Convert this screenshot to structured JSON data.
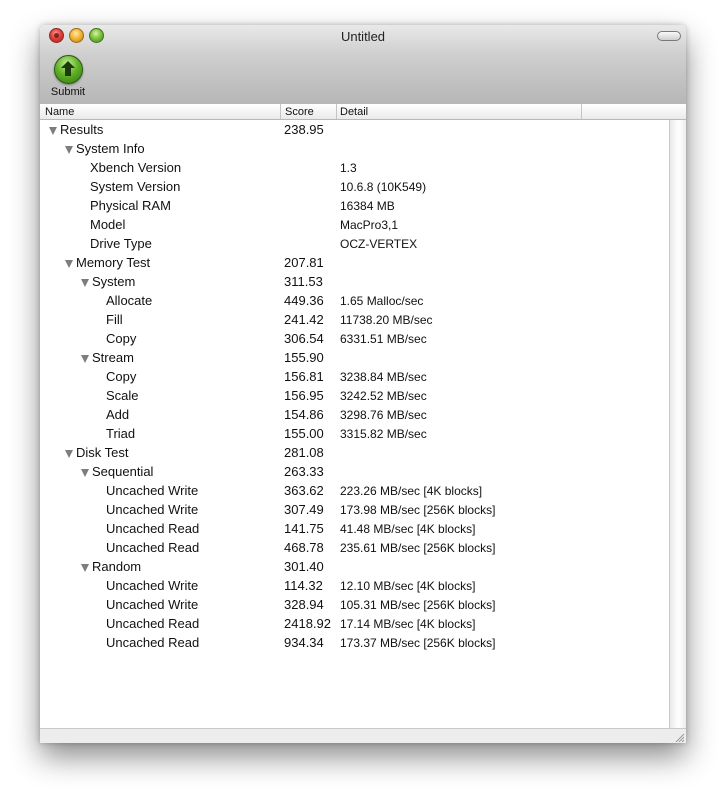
{
  "window": {
    "title": "Untitled"
  },
  "toolbar": {
    "submit_label": "Submit",
    "submit_icon": "up-arrow-green-circle-icon"
  },
  "columns": {
    "name": "Name",
    "score": "Score",
    "detail": "Detail"
  },
  "rows": [
    {
      "name": "Results",
      "score": "238.95",
      "detail": "",
      "level": 0,
      "expandable": true
    },
    {
      "name": "System Info",
      "score": "",
      "detail": "",
      "level": 1,
      "expandable": true
    },
    {
      "name": "Xbench Version",
      "score": "",
      "detail": "1.3",
      "level": 2,
      "expandable": false
    },
    {
      "name": "System Version",
      "score": "",
      "detail": "10.6.8 (10K549)",
      "level": 2,
      "expandable": false
    },
    {
      "name": "Physical RAM",
      "score": "",
      "detail": "16384 MB",
      "level": 2,
      "expandable": false
    },
    {
      "name": "Model",
      "score": "",
      "detail": "MacPro3,1",
      "level": 2,
      "expandable": false
    },
    {
      "name": "Drive Type",
      "score": "",
      "detail": "OCZ-VERTEX",
      "level": 2,
      "expandable": false
    },
    {
      "name": "Memory Test",
      "score": "207.81",
      "detail": "",
      "level": 1,
      "expandable": true
    },
    {
      "name": "System",
      "score": "311.53",
      "detail": "",
      "level": 2,
      "expandable": true
    },
    {
      "name": "Allocate",
      "score": "449.36",
      "detail": "1.65 Malloc/sec",
      "level": 3,
      "expandable": false
    },
    {
      "name": "Fill",
      "score": "241.42",
      "detail": "11738.20 MB/sec",
      "level": 3,
      "expandable": false
    },
    {
      "name": "Copy",
      "score": "306.54",
      "detail": "6331.51 MB/sec",
      "level": 3,
      "expandable": false
    },
    {
      "name": "Stream",
      "score": "155.90",
      "detail": "",
      "level": 2,
      "expandable": true
    },
    {
      "name": "Copy",
      "score": "156.81",
      "detail": "3238.84 MB/sec",
      "level": 3,
      "expandable": false
    },
    {
      "name": "Scale",
      "score": "156.95",
      "detail": "3242.52 MB/sec",
      "level": 3,
      "expandable": false
    },
    {
      "name": "Add",
      "score": "154.86",
      "detail": "3298.76 MB/sec",
      "level": 3,
      "expandable": false
    },
    {
      "name": "Triad",
      "score": "155.00",
      "detail": "3315.82 MB/sec",
      "level": 3,
      "expandable": false
    },
    {
      "name": "Disk Test",
      "score": "281.08",
      "detail": "",
      "level": 1,
      "expandable": true
    },
    {
      "name": "Sequential",
      "score": "263.33",
      "detail": "",
      "level": 2,
      "expandable": true
    },
    {
      "name": "Uncached Write",
      "score": "363.62",
      "detail": "223.26 MB/sec [4K blocks]",
      "level": 3,
      "expandable": false
    },
    {
      "name": "Uncached Write",
      "score": "307.49",
      "detail": "173.98 MB/sec [256K blocks]",
      "level": 3,
      "expandable": false
    },
    {
      "name": "Uncached Read",
      "score": "141.75",
      "detail": "41.48 MB/sec [4K blocks]",
      "level": 3,
      "expandable": false
    },
    {
      "name": "Uncached Read",
      "score": "468.78",
      "detail": "235.61 MB/sec [256K blocks]",
      "level": 3,
      "expandable": false
    },
    {
      "name": "Random",
      "score": "301.40",
      "detail": "",
      "level": 2,
      "expandable": true
    },
    {
      "name": "Uncached Write",
      "score": "114.32",
      "detail": "12.10 MB/sec [4K blocks]",
      "level": 3,
      "expandable": false
    },
    {
      "name": "Uncached Write",
      "score": "328.94",
      "detail": "105.31 MB/sec [256K blocks]",
      "level": 3,
      "expandable": false
    },
    {
      "name": "Uncached Read",
      "score": "2418.92",
      "detail": "17.14 MB/sec [4K blocks]",
      "level": 3,
      "expandable": false
    },
    {
      "name": "Uncached Read",
      "score": "934.34",
      "detail": "173.37 MB/sec [256K blocks]",
      "level": 3,
      "expandable": false
    }
  ]
}
